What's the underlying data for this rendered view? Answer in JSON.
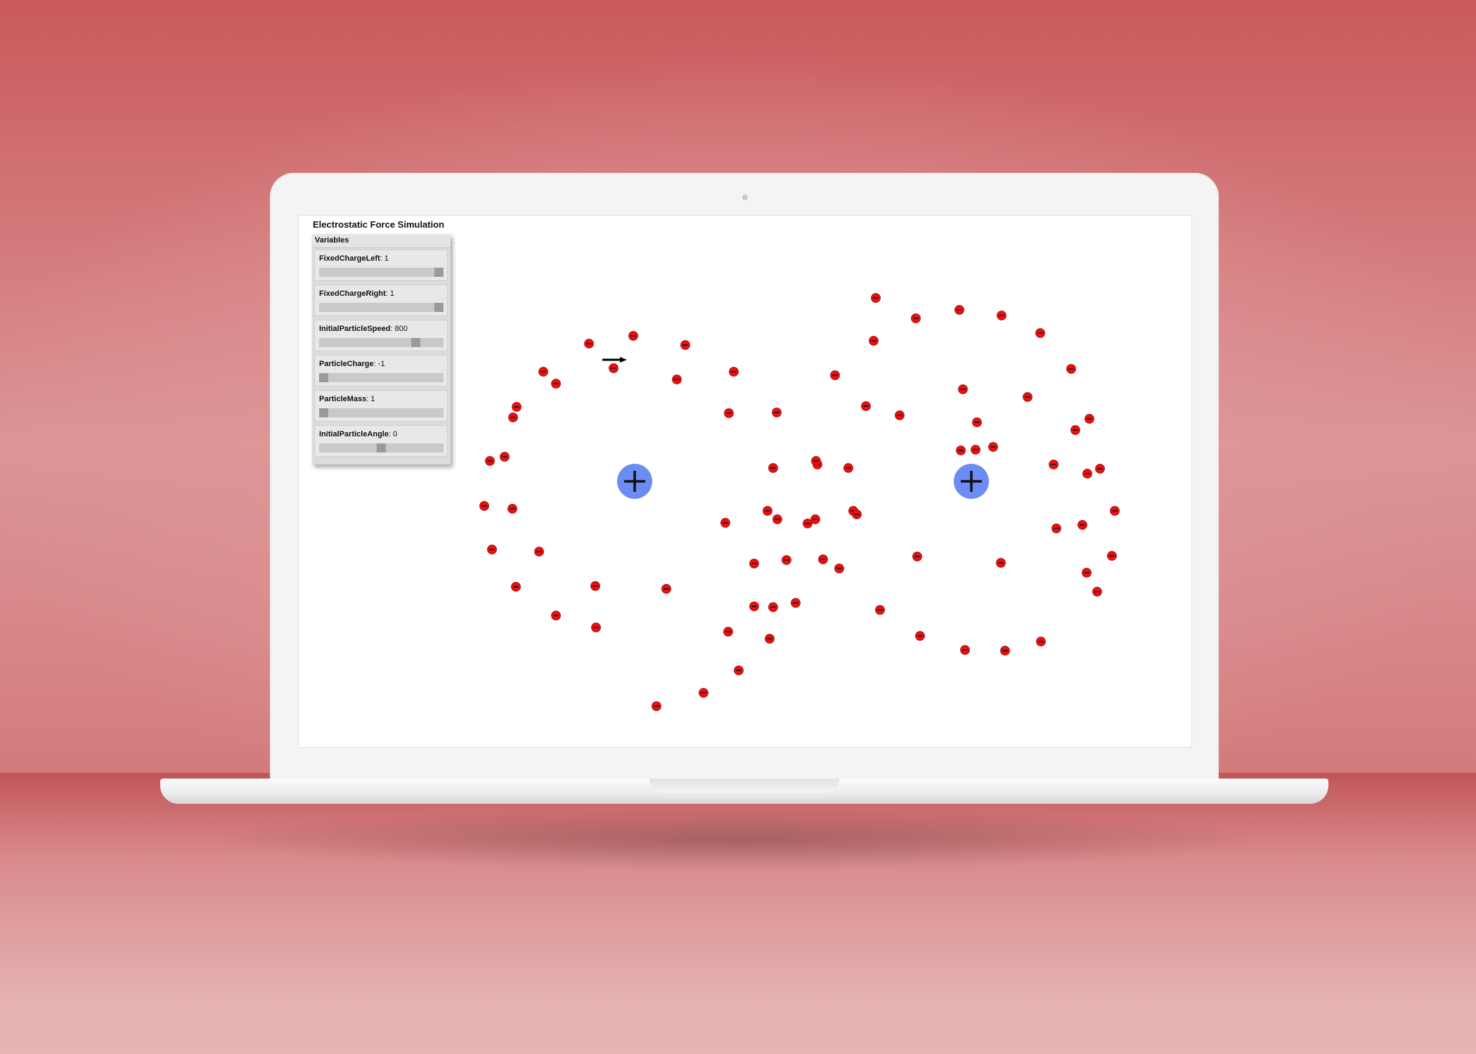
{
  "app": {
    "title": "Electrostatic Force Simulation"
  },
  "panel": {
    "header": "Variables",
    "variables": [
      {
        "name": "FixedChargeLeft",
        "value": "1",
        "fraction": 1.0
      },
      {
        "name": "FixedChargeRight",
        "value": "1",
        "fraction": 1.0
      },
      {
        "name": "InitialParticleSpeed",
        "value": "800",
        "fraction": 0.8
      },
      {
        "name": "ParticleCharge",
        "value": "-1",
        "fraction": 0.0
      },
      {
        "name": "ParticleMass",
        "value": "1",
        "fraction": 0.0
      },
      {
        "name": "InitialParticleAngle",
        "value": "0",
        "fraction": 0.5
      }
    ]
  },
  "colors": {
    "fixed_charge": "#6b8cf2",
    "particle": "#e81010",
    "panel_bg": "#dcdcdc",
    "slider_track": "#c9c9c9",
    "slider_thumb": "#9a9a9a"
  },
  "simulation": {
    "fixed_charges": [
      {
        "id": "left",
        "sign": "+"
      },
      {
        "id": "right",
        "sign": "+"
      }
    ],
    "particle_sign": "-",
    "launcher_icon": "arrow-right-icon",
    "particle_count": 100
  }
}
